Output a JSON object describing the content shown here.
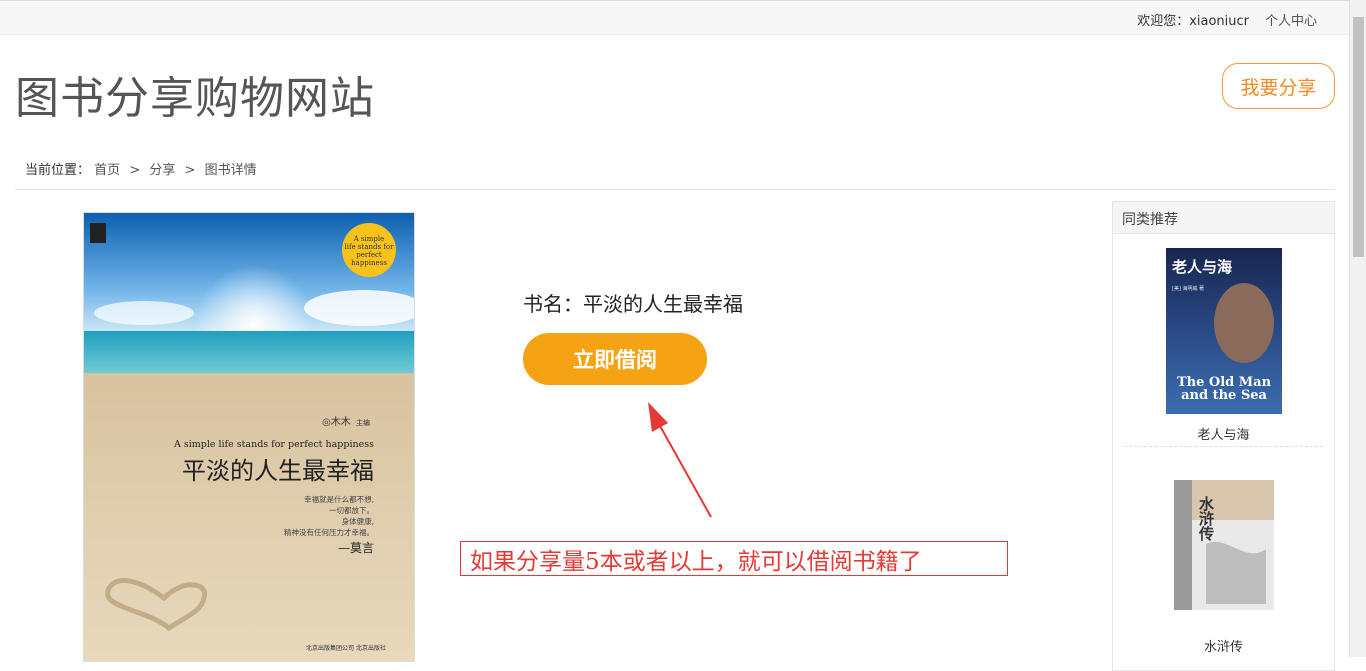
{
  "topbar": {
    "welcome": "欢迎您：xiaoniucr",
    "personal_center": "个人中心"
  },
  "site_title": "图书分享购物网站",
  "share_button": "我要分享",
  "breadcrumb": {
    "prefix": "当前位置：",
    "items": [
      "首页",
      "分享",
      "图书详情"
    ],
    "separator": ">"
  },
  "book": {
    "name_label": "书名：平淡的人生最幸福",
    "cover": {
      "badge": [
        "A simple",
        "life stands for",
        "perfect",
        "happiness"
      ],
      "author": "◎木木",
      "editor_tag": "主编",
      "english_title": "A simple life stands for perfect happiness",
      "chinese_title": "平淡的人生最幸福",
      "quote_lines": [
        "幸福就是什么都不想,",
        "一切都放下。",
        "身体健康,",
        "精神没有任何压力才幸福。"
      ],
      "quote_author": "—莫言",
      "publisher": "北京出版集团公司 北京出版社"
    }
  },
  "borrow_button": "立即借阅",
  "annotation": "如果分享量5本或者以上，就可以借阅书籍了",
  "sidebar": {
    "heading": "同类推荐",
    "items": [
      {
        "title": "老人与海",
        "cover_cn": "老人与海",
        "cover_en_1": "The Old Man",
        "cover_en_2": "and the Sea",
        "cover_tag": "[美] 海明威 著"
      },
      {
        "title": "水浒传",
        "cover_cn": "水浒传"
      }
    ]
  },
  "colors": {
    "accent_orange": "#f5a313",
    "share_border": "#f19a3c",
    "annotation_red": "#e53935"
  }
}
